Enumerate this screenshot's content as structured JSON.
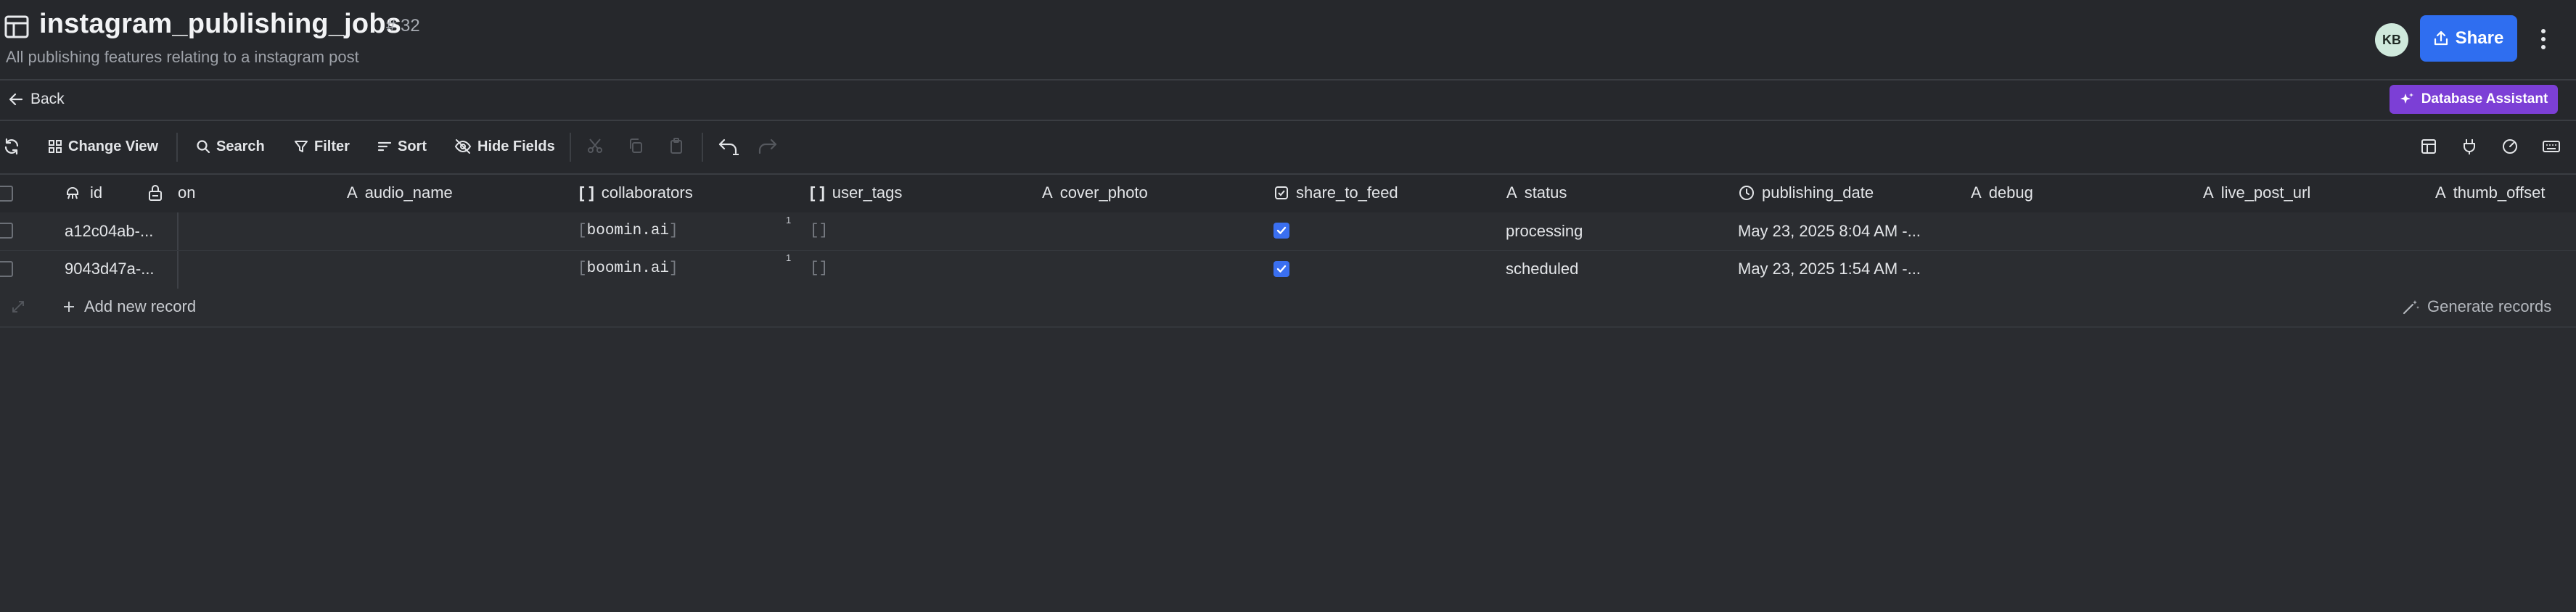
{
  "header": {
    "title": "instagram_publishing_jobs",
    "count": "# 32",
    "subtitle": "All publishing features relating to a instagram post",
    "avatar_initials": "KB",
    "share_label": "Share"
  },
  "nav": {
    "back_label": "Back",
    "assistant_label": "Database Assistant"
  },
  "toolbar": {
    "change_view": "Change View",
    "search": "Search",
    "filter": "Filter",
    "sort": "Sort",
    "hide_fields": "Hide Fields"
  },
  "columns": {
    "id": "id",
    "partial": "on",
    "audio_name": "audio_name",
    "collaborators": "collaborators",
    "user_tags": "user_tags",
    "cover_photo": "cover_photo",
    "share_to_feed": "share_to_feed",
    "status": "status",
    "publishing_date": "publishing_date",
    "debug": "debug",
    "live_post_url": "live_post_url",
    "thumb_offset": "thumb_offset"
  },
  "rows": [
    {
      "id": "a12c04ab-...",
      "collaborator": "boomin.ai",
      "collaborators_count": "1",
      "user_tags": "[]",
      "share_to_feed": true,
      "status": "processing",
      "publishing_date": "May 23, 2025 8:04 AM -..."
    },
    {
      "id": "9043d47a-...",
      "collaborator": "boomin.ai",
      "collaborators_count": "1",
      "user_tags": "[]",
      "share_to_feed": true,
      "status": "scheduled",
      "publishing_date": "May 23, 2025 1:54 AM -..."
    }
  ],
  "footer": {
    "add_record": "Add new record",
    "generate_records": "Generate records"
  },
  "colors": {
    "accent": "#2f6ef0",
    "assistant": "#7c3fd6",
    "background": "#2a2c30"
  }
}
